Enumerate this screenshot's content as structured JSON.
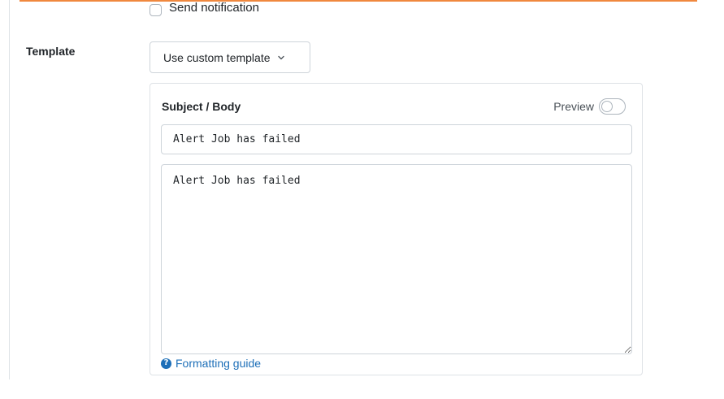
{
  "notification": {
    "label": "Send notification",
    "checked": false
  },
  "template": {
    "label": "Template",
    "dropdown_value": "Use custom template"
  },
  "editor": {
    "section_label": "Subject / Body",
    "preview_label": "Preview",
    "preview_enabled": false,
    "subject_value": "Alert Job has failed",
    "body_value": "Alert Job has failed",
    "formatting_guide_label": "Formatting guide"
  },
  "colors": {
    "accent": "#f0883e",
    "link": "#1d6fb8"
  }
}
